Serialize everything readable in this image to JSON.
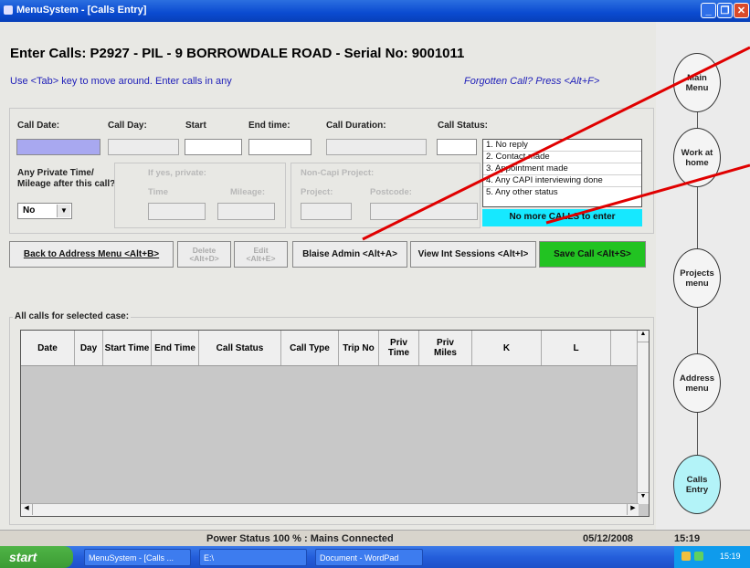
{
  "window": {
    "title": "MenuSystem - [Calls Entry]"
  },
  "heading": "Enter Calls: P2927 - PIL - 9 BORROWDALE ROAD - Serial No: 9001011",
  "instructions": {
    "tab_hint": "Use <Tab> key to move around.  Enter calls in any",
    "forgotten_hint": "Forgotten Call?  Press <Alt+F>"
  },
  "fields": {
    "call_date": "Call Date:",
    "call_day": "Call Day:",
    "start": "Start",
    "end_time": "End time:",
    "call_duration": "Call Duration:",
    "call_status": "Call Status:"
  },
  "private": {
    "label_line1": "Any Private Time/",
    "label_line2": "Mileage after this call?",
    "if_yes": "If yes, private:",
    "time": "Time",
    "mileage": "Mileage:",
    "select_value": "No"
  },
  "noncapi": {
    "label": "Non-Capi Project:",
    "project": "Project:",
    "postcode": "Postcode:"
  },
  "status_options": [
    "1. No reply",
    "2. Contact made",
    "3. Appointment made",
    "4. Any CAPI interviewing done",
    "5. Any other status"
  ],
  "no_more_calls": "No more CALLS to enter",
  "buttons": {
    "back": "Back to Address Menu <Alt+B>",
    "delete_1": "Delete",
    "delete_2": "<Alt+D>",
    "edit_1": "Edit",
    "edit_2": "<Alt+E>",
    "blaise": "Blaise Admin <Alt+A>",
    "view": "View Int Sessions <Alt+I>",
    "save": "Save Call <Alt+S>"
  },
  "table": {
    "group_label": "All calls for selected case:",
    "columns": [
      "Date",
      "Day",
      "Start Time",
      "End Time",
      "Call Status",
      "Call Type",
      "Trip No",
      "Priv Time",
      "Priv Miles",
      "K",
      "L"
    ]
  },
  "sidebar": {
    "items": [
      "Main Menu",
      "Work at home",
      "Projects menu",
      "Address menu",
      "Calls Entry"
    ]
  },
  "statusbar": {
    "power": "Power Status 100 % : Mains Connected",
    "date": "05/12/2008",
    "time": "15:19"
  },
  "taskbar": {
    "start": "start",
    "tasks": [
      "MenuSystem - [Calls ...",
      "E:\\",
      "Document - WordPad"
    ],
    "clock": "15:19"
  },
  "colors": {
    "no_more_bg": "#16e8ff",
    "save_bg": "#22c322",
    "call_date_bg": "#a8a8f0",
    "active_oval": "#b3f3f8",
    "annotation_line": "#e00000"
  }
}
